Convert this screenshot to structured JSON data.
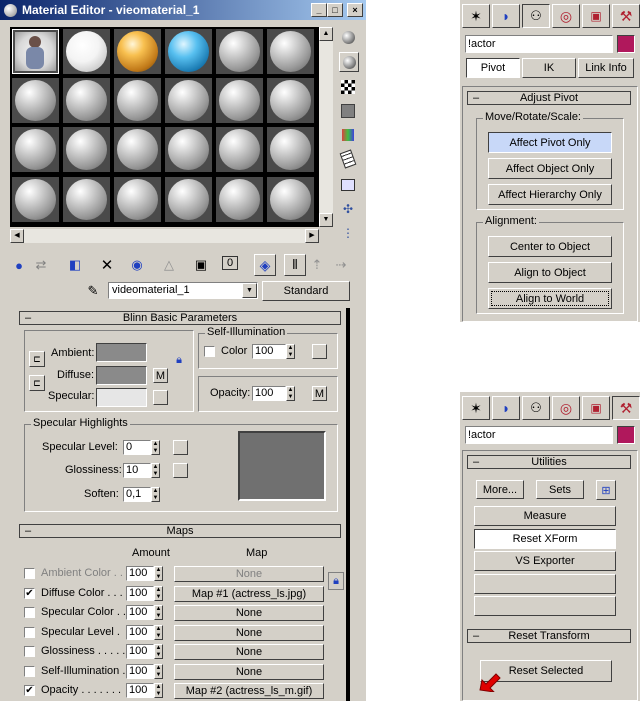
{
  "material_editor": {
    "title": "Material Editor - vieomaterial_1",
    "material_name": "videomaterial_1",
    "material_type": "Standard",
    "blinn_rollout": "Blinn Basic Parameters",
    "ambient_label": "Ambient:",
    "diffuse_label": "Diffuse:",
    "specular_label": "Specular:",
    "m_label": "M",
    "selfillum_group": "Self-Illumination",
    "color_label": "Color",
    "color_value": "100",
    "opacity_label": "Opacity:",
    "opacity_value": "100",
    "spec_highlights_group": "Specular Highlights",
    "spec_level_label": "Specular Level:",
    "spec_level_value": "0",
    "glossiness_label": "Glossiness:",
    "glossiness_value": "10",
    "soften_label": "Soften:",
    "soften_value": "0,1",
    "maps_rollout": "Maps",
    "amount_header": "Amount",
    "map_header": "Map",
    "maps": [
      {
        "label": "Ambient Color . . .",
        "amount": "100",
        "map": "None",
        "checked": false,
        "dim": true
      },
      {
        "label": "Diffuse Color . . . .",
        "amount": "100",
        "map": "Map #1 (actress_ls.jpg)",
        "checked": true,
        "dim": false
      },
      {
        "label": "Specular Color . .",
        "amount": "100",
        "map": "None",
        "checked": false,
        "dim": false
      },
      {
        "label": "Specular Level .",
        "amount": "100",
        "map": "None",
        "checked": false,
        "dim": false
      },
      {
        "label": "Glossiness . . . . .",
        "amount": "100",
        "map": "None",
        "checked": false,
        "dim": false
      },
      {
        "label": "Self-Illumination .",
        "amount": "100",
        "map": "None",
        "checked": false,
        "dim": false
      },
      {
        "label": "Opacity . . . . . . .",
        "amount": "100",
        "map": "Map #2 (actress_ls_m.gif)",
        "checked": true,
        "dim": false
      }
    ]
  },
  "hierarchy_panel": {
    "object_name": "!actor",
    "tabs": [
      "Pivot",
      "IK",
      "Link Info"
    ],
    "adjust_pivot_rollout": "Adjust Pivot",
    "move_group": "Move/Rotate/Scale:",
    "affect_pivot_only": "Affect Pivot Only",
    "affect_object_only": "Affect Object Only",
    "affect_hierarchy_only": "Affect Hierarchy Only",
    "alignment_group": "Alignment:",
    "center_to_object": "Center to Object",
    "align_to_object": "Align to Object",
    "align_to_world": "Align to World"
  },
  "utilities_panel": {
    "object_name": "!actor",
    "utilities_rollout": "Utilities",
    "more_label": "More...",
    "sets_label": "Sets",
    "utility_buttons": [
      "Measure",
      "Reset XForm",
      "VS Exporter",
      "",
      ""
    ],
    "reset_transform_rollout": "Reset Transform",
    "reset_selected": "Reset Selected"
  },
  "colors": {
    "panel": "#d4d0c8",
    "title_blue": "#0a246a",
    "swatch_magenta": "#b0185c",
    "highlight_button": "#c8d8f8",
    "arrow_red": "#e00000"
  }
}
